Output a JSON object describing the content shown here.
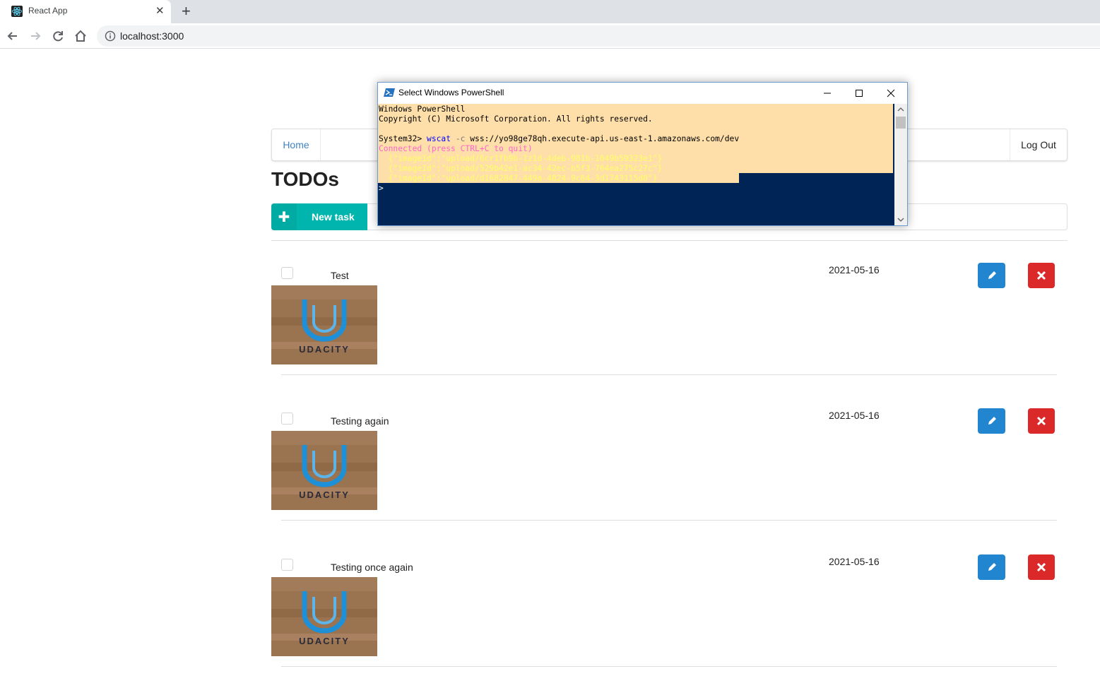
{
  "browser": {
    "tab_title": "React App",
    "url": "localhost:3000"
  },
  "app": {
    "menu": {
      "home": "Home",
      "logout": "Log Out"
    },
    "title": "TODOs",
    "new_task_label": "New task",
    "image_caption": "UDACITY",
    "todos": [
      {
        "name": "Test",
        "date": "2021-05-16",
        "done": false
      },
      {
        "name": "Testing again",
        "date": "2021-05-16",
        "done": false
      },
      {
        "name": "Testing once again",
        "date": "2021-05-16",
        "done": false
      }
    ]
  },
  "powershell": {
    "title": "Select Windows PowerShell",
    "line1": "Windows PowerShell",
    "line2": "Copyright (C) Microsoft Corporation. All rights reserved.",
    "prompt": "System32> ",
    "cmd": "wscat",
    "flag": " -c ",
    "arg": "wss://yo98ge78qh.execute-api.us-east-1.amazonaws.com/dev",
    "connected": "Connected (press CTRL+C to quit)",
    "msg1": "  {\"imageId\":\"upload/6cr1fb9b-1z1d-4deb-981b-1649b59323e1\"}",
    "msg2": "  {\"imageId\":\"upload/529b42e1-ac34-42ec-b5f3-764ea275c27c\"}",
    "msg3": "  {\"imageId\":\"upload/d1682847-449a-4824-9c64-3d1743115d0\"}",
    "cursor": ">",
    "colors": {
      "background": "#012456",
      "selection": "#ffdfa9",
      "cmd": "#0000ff",
      "connected": "#ff66cc",
      "message": "#ffff66"
    }
  }
}
